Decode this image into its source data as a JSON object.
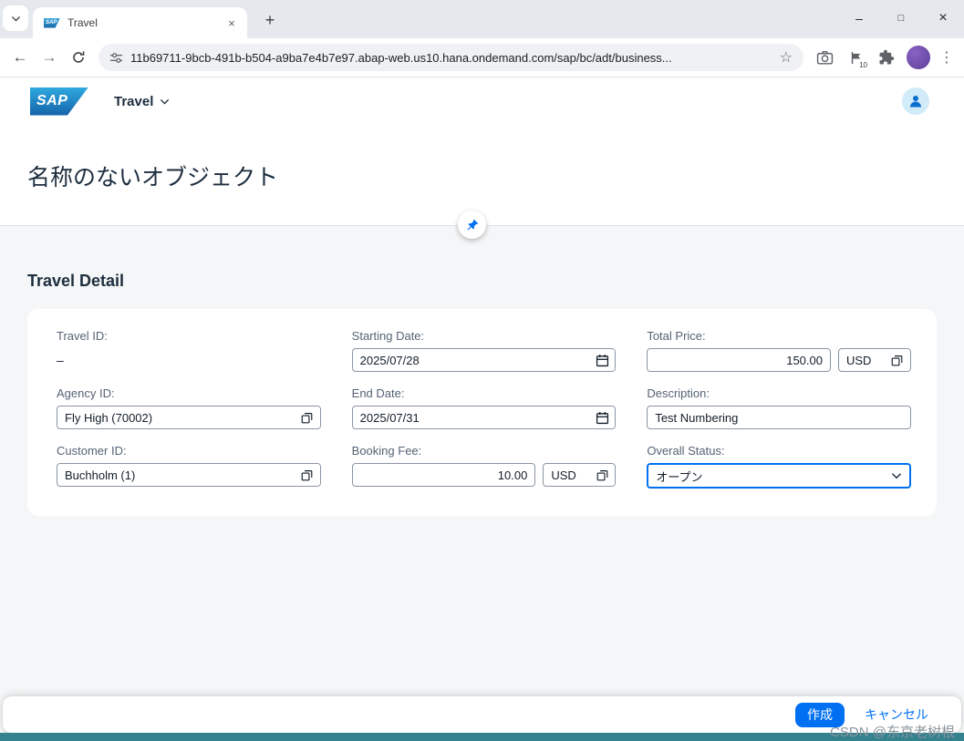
{
  "colors": {
    "accent": "#0070F2",
    "status_strip": "#35828F",
    "shell_bg": "#FFFFFF",
    "content_bg": "#F5F6F7"
  },
  "icons": {
    "back": "←",
    "forward": "→",
    "menu": "⋮",
    "star": "☆",
    "new_tab": "+",
    "tab_close": "×",
    "minimize": "–",
    "maximize": "□",
    "close_window": "×"
  },
  "browser": {
    "tab": {
      "title": "Travel",
      "favicon_text": "SAP"
    },
    "url": "11b69711-9bcb-491b-b504-a9ba7e4b7e97.abap-web.us10.hana.ondemand.com/sap/bc/adt/business...",
    "flag_count": "10"
  },
  "shell": {
    "logo_text": "SAP",
    "app_menu_label": "Travel"
  },
  "page": {
    "title": "名称のないオブジェクト",
    "section_title": "Travel Detail"
  },
  "form": {
    "travel_id": {
      "label": "Travel ID:",
      "value": "–"
    },
    "agency_id": {
      "label": "Agency ID:",
      "value": "Fly High (70002)"
    },
    "customer_id": {
      "label": "Customer ID:",
      "value": "Buchholm (1)"
    },
    "starting_date": {
      "label": "Starting Date:",
      "value": "2025/07/28"
    },
    "end_date": {
      "label": "End Date:",
      "value": "2025/07/31"
    },
    "booking_fee": {
      "label": "Booking Fee:",
      "value": "10.00",
      "currency": "USD"
    },
    "total_price": {
      "label": "Total Price:",
      "value": "150.00",
      "currency": "USD"
    },
    "description": {
      "label": "Description:",
      "value": "Test Numbering"
    },
    "overall_status": {
      "label": "Overall Status:",
      "value": "オープン"
    }
  },
  "footer": {
    "create": "作成",
    "cancel": "キャンセル"
  },
  "watermark": "CSDN @东京老树根"
}
